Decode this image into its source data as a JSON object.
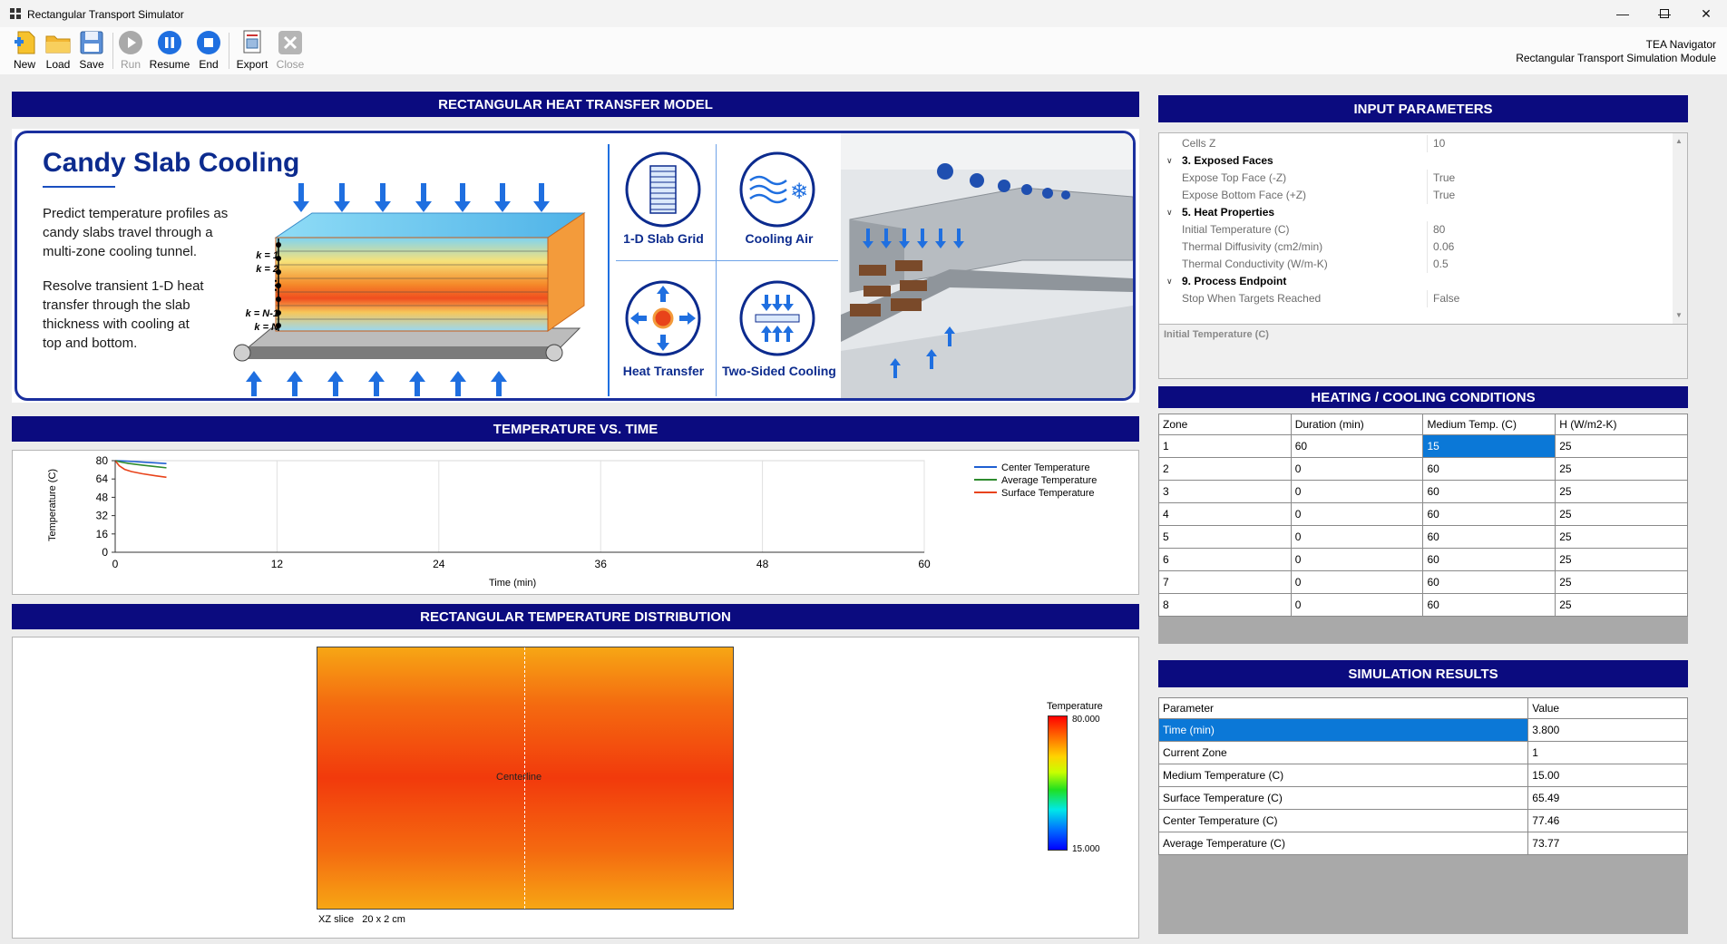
{
  "window": {
    "title": "Rectangular Transport Simulator"
  },
  "toolbar": {
    "buttons": [
      {
        "label": "New",
        "icon": "new-icon",
        "enabled": true
      },
      {
        "label": "Load",
        "icon": "folder-icon",
        "enabled": true
      },
      {
        "label": "Save",
        "icon": "save-icon",
        "enabled": true
      },
      {
        "label": "Run",
        "icon": "play-icon",
        "enabled": false
      },
      {
        "label": "Resume",
        "icon": "pause-icon",
        "enabled": true
      },
      {
        "label": "End",
        "icon": "stop-icon",
        "enabled": true
      },
      {
        "label": "Export",
        "icon": "export-icon",
        "enabled": true
      },
      {
        "label": "Close",
        "icon": "close-icon",
        "enabled": false
      }
    ]
  },
  "branding": {
    "line1": "TEA Navigator",
    "line2": "Rectangular Transport Simulation Module"
  },
  "model": {
    "header": "RECTANGULAR HEAT TRANSFER MODEL",
    "title": "Candy Slab Cooling",
    "text1": [
      "Predict temperature profiles as",
      "candy slabs travel through a",
      "multi-zone cooling tunnel."
    ],
    "text2": [
      "Resolve transient 1-D heat",
      "transfer through the slab",
      "thickness with cooling at",
      "top and bottom."
    ],
    "layer_labels": [
      "k = 1",
      "k = 2",
      "k = N-1",
      "k = N"
    ],
    "features": [
      "1-D Slab Grid",
      "Cooling Air",
      "Heat Transfer",
      "Two-Sided Cooling"
    ]
  },
  "chart_header": "TEMPERATURE VS. TIME",
  "chart_data": {
    "type": "line",
    "xlabel": "Time (min)",
    "ylabel": "Temperature (C)",
    "xlim": [
      0,
      60
    ],
    "ylim": [
      0,
      80
    ],
    "xticks": [
      0,
      12,
      24,
      36,
      48,
      60
    ],
    "yticks": [
      0,
      16,
      32,
      48,
      64,
      80
    ],
    "grid": true,
    "legend_position": "top-right",
    "series": [
      {
        "name": "Center Temperature",
        "color": "#1f5fd1",
        "x": [
          0,
          0.5,
          1,
          2,
          3,
          3.8
        ],
        "y": [
          80,
          79.8,
          79.5,
          78.8,
          78.1,
          77.46
        ]
      },
      {
        "name": "Average Temperature",
        "color": "#2e8b2e",
        "x": [
          0,
          0.5,
          1,
          2,
          3,
          3.8
        ],
        "y": [
          80,
          78.6,
          77.6,
          76.1,
          74.8,
          73.77
        ]
      },
      {
        "name": "Surface Temperature",
        "color": "#e8431a",
        "x": [
          0,
          0.3,
          0.7,
          1.2,
          2,
          3,
          3.8
        ],
        "y": [
          80,
          75.5,
          72.4,
          70.5,
          68.6,
          66.8,
          65.49
        ]
      }
    ]
  },
  "distribution": {
    "header": "RECTANGULAR TEMPERATURE DISTRIBUTION",
    "centerline_label": "Centerline",
    "slice_label": "XZ slice   20 x 2 cm",
    "colorbar": {
      "title": "Temperature",
      "max": "80.000",
      "min": "15.000"
    }
  },
  "input": {
    "header": "INPUT PARAMETERS",
    "rows": [
      {
        "kind": "prop",
        "key": "Cells Z",
        "value": "10"
      },
      {
        "kind": "cat",
        "key": "3. Exposed Faces"
      },
      {
        "kind": "prop",
        "key": "Expose Top Face (-Z)",
        "value": "True"
      },
      {
        "kind": "prop",
        "key": "Expose Bottom Face (+Z)",
        "value": "True"
      },
      {
        "kind": "cat",
        "key": "5. Heat Properties"
      },
      {
        "kind": "prop",
        "key": "Initial Temperature (C)",
        "value": "80"
      },
      {
        "kind": "prop",
        "key": "Thermal Diffusivity (cm2/min)",
        "value": "0.06"
      },
      {
        "kind": "prop",
        "key": "Thermal Conductivity (W/m-K)",
        "value": "0.5"
      },
      {
        "kind": "cat",
        "key": "9. Process Endpoint"
      },
      {
        "kind": "prop",
        "key": "Stop When Targets Reached",
        "value": "False"
      }
    ],
    "description_title": "Initial Temperature (C)"
  },
  "conditions": {
    "header": "HEATING / COOLING CONDITIONS",
    "columns": [
      "Zone",
      "Duration (min)",
      "Medium Temp. (C)",
      "H (W/m2-K)"
    ],
    "rows": [
      [
        "1",
        "60",
        "15",
        "25"
      ],
      [
        "2",
        "0",
        "60",
        "25"
      ],
      [
        "3",
        "0",
        "60",
        "25"
      ],
      [
        "4",
        "0",
        "60",
        "25"
      ],
      [
        "5",
        "0",
        "60",
        "25"
      ],
      [
        "6",
        "0",
        "60",
        "25"
      ],
      [
        "7",
        "0",
        "60",
        "25"
      ],
      [
        "8",
        "0",
        "60",
        "25"
      ]
    ]
  },
  "results": {
    "header": "SIMULATION RESULTS",
    "columns": [
      "Parameter",
      "Value"
    ],
    "rows": [
      [
        "Time (min)",
        "3.800"
      ],
      [
        "Current Zone",
        "1"
      ],
      [
        "Medium Temperature (C)",
        "15.00"
      ],
      [
        "Surface Temperature (C)",
        "65.49"
      ],
      [
        "Center Temperature (C)",
        "77.46"
      ],
      [
        "Average Temperature (C)",
        "73.77"
      ]
    ]
  }
}
